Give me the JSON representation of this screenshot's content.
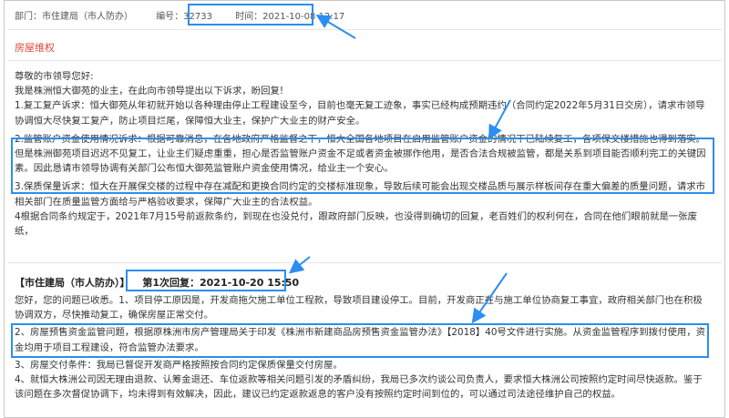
{
  "header": {
    "dept": "部门：市住建局（市人防办）",
    "number": "编号：32733",
    "time": "时间：2021-10-08 12:17"
  },
  "category": "房屋维权",
  "letter": {
    "greeting": "尊敬的市领导您好:",
    "intro": "我是株洲恒大御苑的业主，在此向市领导提出以下诉求，盼回复!",
    "p1": "1.复工复产诉求：恒大御苑从年初就开始以各种理由停止工程建设至今，目前也毫无复工迹象，事实已经构成预期违约（合同约定2022年5月31日交房），请求市领导协调恒大尽快复工复产，防止项目烂尾，保障恒大业主，保护广大业主的财产安全。",
    "p2": "2.监管账户资金使用情况诉求：根据可靠消息，在各地政府严格监督之下，恒大全国各地项目在启用监管账户资金的情况下已陆续复工，各项保交楼措施也得到落实。但是株洲御苑项目迟迟不见复工，让业主们疑虑重重，担心是否监管账户资金不足或者资金被挪作他用，是否合法合规被监管，都是关系到项目能否顺利完工的关键因素。因此恳请市领导协调有关部门公布恒大御苑监管账户资金使用情况，给业主一个安心。",
    "p3": "3.保质保量诉求：恒大在开展保交楼的过程中存在减配和更换合同约定的交楼标准现象，导致后续可能会出现交楼品质与展示样板间存在重大偏差的质量问题，请求市相关部门在质量监管方面给与严格验收要求，保障广大业主的合法权益。",
    "p4": "4根据合同条约规定于，2021年7月15号前返款条约，到现在也没兑付，跟政府部门反映，也没得到确切的回复，老百姓们的权利何在，合同在他们眼前就是一张废纸，"
  },
  "reply": {
    "dept": "【市住建局（市人防办）】",
    "label": "第1次回复：2021-10-20 15:50",
    "greeting": "您好，您的问题已收悉。1、项目停工原因是，开发商拖欠施工单位工程款，导致项目建设停工。目前，开发商正在与施工单位协商复工事宜，政府相关部门也在积极协调双方，尽快推动复工，确保房屋正常交付。",
    "p2": "2、房屋预售资金监管问题，根据原株洲市房产管理局关于印发《株洲市新建商品房预售资金监管办法》【2018】40号文件进行实施。从资金监管程序到拨付使用，资金均用于项目工程建设，符合监管办法要求。",
    "p3": "3、房屋交付条件：我局已督促开发商严格按照按合同约定保质保量交付房屋。",
    "p4": "4、就恒大株洲公司因无理由退款、认筹金退还、车位返款等相关问题引发的矛盾纠纷，我局已多次约谈公司负责人，要求恒大株洲公司按照约定时间尽快返款。鉴于该问题在多次督促协调下，均未得到有效解决，因此，建议已约定返款返息的客户没有按照约定时间到位的，可以通过司法途径维护自己的权益。"
  },
  "colors": {
    "highlight": "#2b8ef0",
    "category": "#e0463a"
  }
}
